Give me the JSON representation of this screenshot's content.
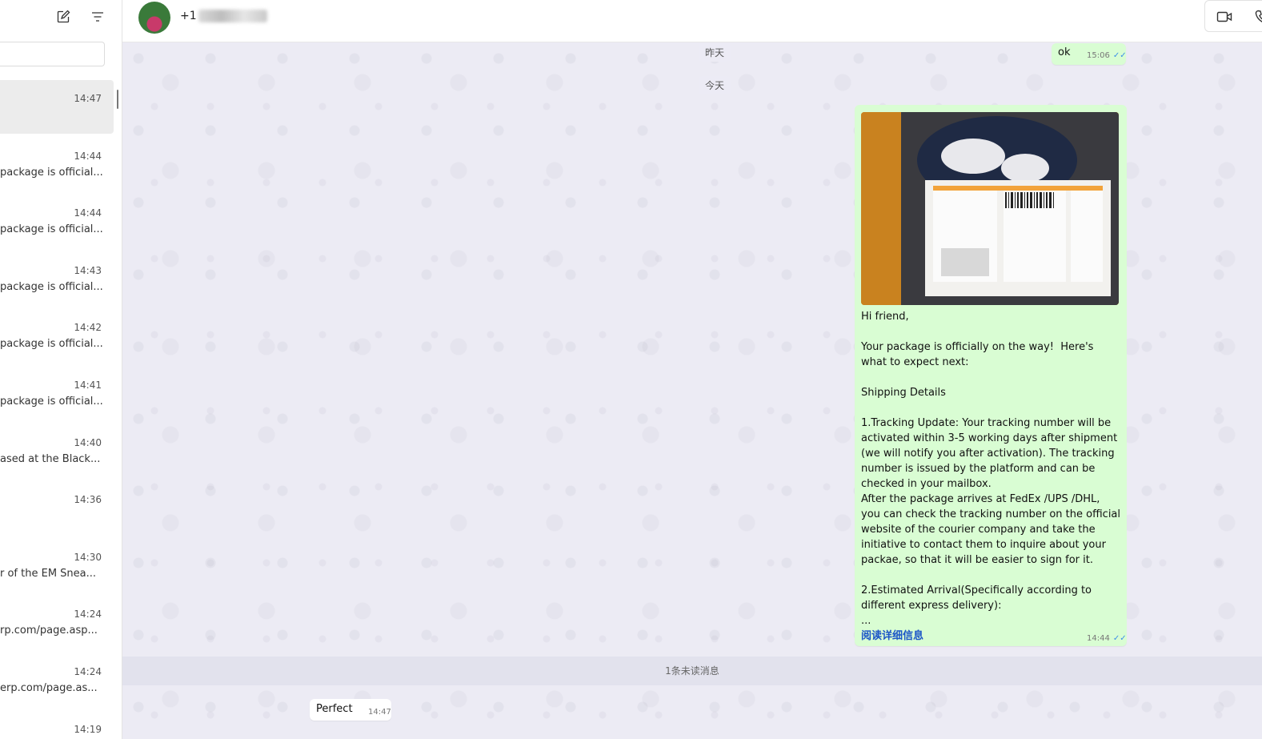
{
  "sidebar": {
    "chats": [
      {
        "time": "14:47",
        "preview": ""
      },
      {
        "time": "14:44",
        "preview": "package is official..."
      },
      {
        "time": "14:44",
        "preview": "package is official..."
      },
      {
        "time": "14:43",
        "preview": "package is official..."
      },
      {
        "time": "14:42",
        "preview": "package is official..."
      },
      {
        "time": "14:41",
        "preview": "package is official..."
      },
      {
        "time": "14:40",
        "preview": "ased at the Black..."
      },
      {
        "time": "14:36",
        "preview": ""
      },
      {
        "time": "14:30",
        "preview": "r of the EM Snea..."
      },
      {
        "time": "14:24",
        "preview": "rp.com/page.asp..."
      },
      {
        "time": "14:24",
        "preview": "erp.com/page.as..."
      },
      {
        "time": "14:19",
        "preview": ""
      }
    ]
  },
  "header": {
    "contact_prefix": "+1"
  },
  "conversation": {
    "date_yesterday": "昨天",
    "date_today": "今天",
    "msg_ok": {
      "text": "ok",
      "time": "15:06"
    },
    "msg_shipping": {
      "text": "Hi friend,\n\nYour package is officially on the way!  Here's what to expect next:\n\nShipping Details\n\n1.Tracking Update: Your tracking number will be activated within 3-5 working days after shipment (we will notify you after activation). The tracking number is issued by the platform and can be checked in your mailbox.\nAfter the package arrives at FedEx /UPS /DHL, you can check the tracking number on the official website of the courier company and take the initiative to contact them to inquire about your packae, so that it will be easier to sign for it.\n\n2.Estimated Arrival(Specifically according to different express delivery):\n...",
      "read_more": "阅读详细信息",
      "time": "14:44"
    },
    "unread_label": "1条未读消息",
    "msg_perfect": {
      "text": "Perfect",
      "time": "14:47"
    }
  },
  "icons": {
    "compose": "compose-icon",
    "filter": "filter-icon",
    "video": "video-call-icon",
    "phone": "voice-call-icon",
    "read_receipt": "double-check-icon"
  }
}
